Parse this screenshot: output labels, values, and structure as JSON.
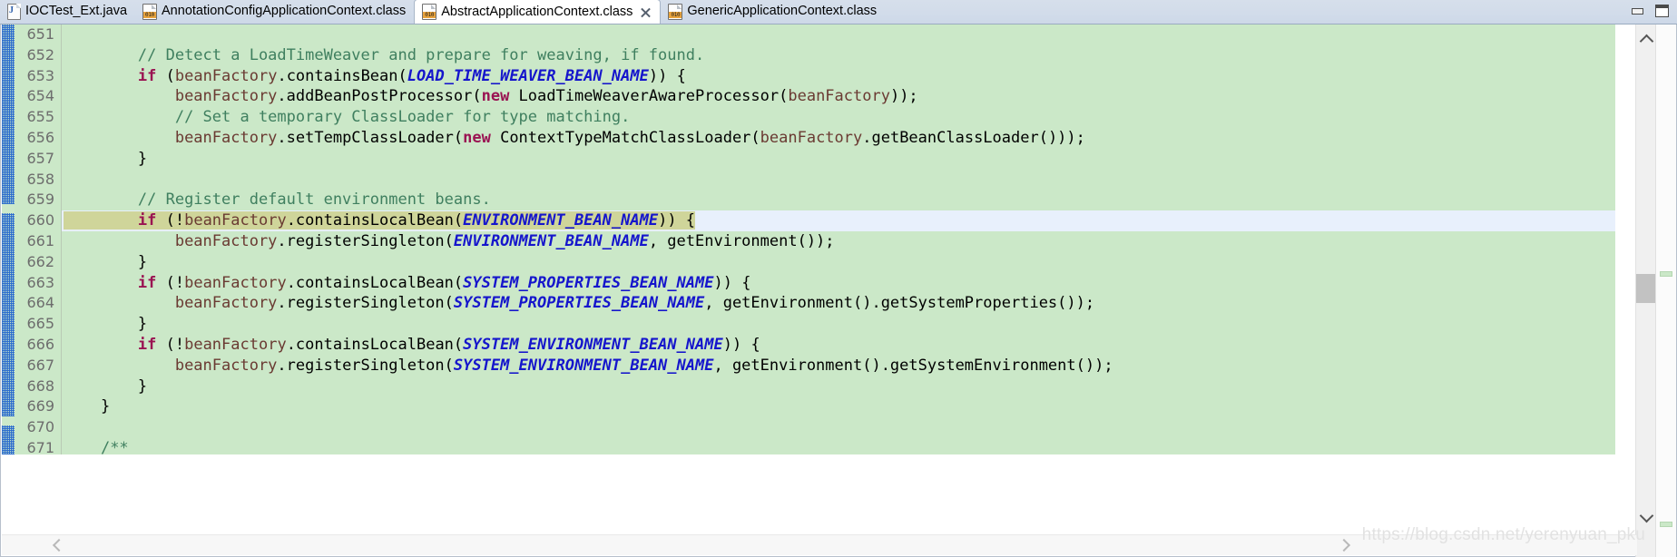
{
  "window": {
    "minimize_label": "Minimize",
    "maximize_label": "Maximize"
  },
  "tabs": [
    {
      "label": "IOCTest_Ext.java",
      "icon": "java-file-icon",
      "active": false,
      "closable": false
    },
    {
      "label": "AnnotationConfigApplicationContext.class",
      "icon": "class-file-icon",
      "active": false,
      "closable": false
    },
    {
      "label": "AbstractApplicationContext.class",
      "icon": "class-file-icon",
      "active": true,
      "closable": true
    },
    {
      "label": "GenericApplicationContext.class",
      "icon": "class-file-icon",
      "active": false,
      "closable": false
    }
  ],
  "editor": {
    "first_line": 651,
    "current_line": 660,
    "fold_line": 671,
    "lines": [
      {
        "n": "651",
        "tokens": []
      },
      {
        "n": "652",
        "tokens": [
          {
            "t": "plain",
            "s": "        "
          },
          {
            "t": "cmt",
            "s": "// Detect a LoadTimeWeaver and prepare for weaving, if found."
          }
        ]
      },
      {
        "n": "653",
        "tokens": [
          {
            "t": "plain",
            "s": "        "
          },
          {
            "t": "kw",
            "s": "if"
          },
          {
            "t": "plain",
            "s": " ("
          },
          {
            "t": "field",
            "s": "beanFactory"
          },
          {
            "t": "plain",
            "s": ".containsBean("
          },
          {
            "t": "const",
            "s": "LOAD_TIME_WEAVER_BEAN_NAME"
          },
          {
            "t": "plain",
            "s": ")) {"
          }
        ]
      },
      {
        "n": "654",
        "tokens": [
          {
            "t": "plain",
            "s": "            "
          },
          {
            "t": "field",
            "s": "beanFactory"
          },
          {
            "t": "plain",
            "s": ".addBeanPostProcessor("
          },
          {
            "t": "kw",
            "s": "new"
          },
          {
            "t": "plain",
            "s": " LoadTimeWeaverAwareProcessor("
          },
          {
            "t": "field",
            "s": "beanFactory"
          },
          {
            "t": "plain",
            "s": "));"
          }
        ]
      },
      {
        "n": "655",
        "tokens": [
          {
            "t": "plain",
            "s": "            "
          },
          {
            "t": "cmt",
            "s": "// Set a temporary ClassLoader for type matching."
          }
        ]
      },
      {
        "n": "656",
        "tokens": [
          {
            "t": "plain",
            "s": "            "
          },
          {
            "t": "field",
            "s": "beanFactory"
          },
          {
            "t": "plain",
            "s": ".setTempClassLoader("
          },
          {
            "t": "kw",
            "s": "new"
          },
          {
            "t": "plain",
            "s": " ContextTypeMatchClassLoader("
          },
          {
            "t": "field",
            "s": "beanFactory"
          },
          {
            "t": "plain",
            "s": ".getBeanClassLoader()));"
          }
        ]
      },
      {
        "n": "657",
        "tokens": [
          {
            "t": "plain",
            "s": "        }"
          }
        ]
      },
      {
        "n": "658",
        "tokens": []
      },
      {
        "n": "659",
        "tokens": [
          {
            "t": "plain",
            "s": "        "
          },
          {
            "t": "cmt",
            "s": "// Register default environment beans."
          }
        ]
      },
      {
        "n": "660",
        "current": true,
        "tokens": [
          {
            "t": "plain",
            "s": "        "
          },
          {
            "t": "kw",
            "s": "if"
          },
          {
            "t": "plain",
            "s": " (!"
          },
          {
            "t": "field",
            "s": "beanFactory"
          },
          {
            "t": "plain",
            "s": ".containsLocalBean("
          },
          {
            "t": "const",
            "s": "ENVIRONMENT_BEAN_NAME"
          },
          {
            "t": "plain",
            "s": ")) {"
          }
        ]
      },
      {
        "n": "661",
        "tokens": [
          {
            "t": "plain",
            "s": "            "
          },
          {
            "t": "field",
            "s": "beanFactory"
          },
          {
            "t": "plain",
            "s": ".registerSingleton("
          },
          {
            "t": "const",
            "s": "ENVIRONMENT_BEAN_NAME"
          },
          {
            "t": "plain",
            "s": ", getEnvironment());"
          }
        ]
      },
      {
        "n": "662",
        "tokens": [
          {
            "t": "plain",
            "s": "        }"
          }
        ]
      },
      {
        "n": "663",
        "tokens": [
          {
            "t": "plain",
            "s": "        "
          },
          {
            "t": "kw",
            "s": "if"
          },
          {
            "t": "plain",
            "s": " (!"
          },
          {
            "t": "field",
            "s": "beanFactory"
          },
          {
            "t": "plain",
            "s": ".containsLocalBean("
          },
          {
            "t": "const",
            "s": "SYSTEM_PROPERTIES_BEAN_NAME"
          },
          {
            "t": "plain",
            "s": ")) {"
          }
        ]
      },
      {
        "n": "664",
        "tokens": [
          {
            "t": "plain",
            "s": "            "
          },
          {
            "t": "field",
            "s": "beanFactory"
          },
          {
            "t": "plain",
            "s": ".registerSingleton("
          },
          {
            "t": "const",
            "s": "SYSTEM_PROPERTIES_BEAN_NAME"
          },
          {
            "t": "plain",
            "s": ", getEnvironment().getSystemProperties());"
          }
        ]
      },
      {
        "n": "665",
        "tokens": [
          {
            "t": "plain",
            "s": "        }"
          }
        ]
      },
      {
        "n": "666",
        "tokens": [
          {
            "t": "plain",
            "s": "        "
          },
          {
            "t": "kw",
            "s": "if"
          },
          {
            "t": "plain",
            "s": " (!"
          },
          {
            "t": "field",
            "s": "beanFactory"
          },
          {
            "t": "plain",
            "s": ".containsLocalBean("
          },
          {
            "t": "const",
            "s": "SYSTEM_ENVIRONMENT_BEAN_NAME"
          },
          {
            "t": "plain",
            "s": ")) {"
          }
        ]
      },
      {
        "n": "667",
        "tokens": [
          {
            "t": "plain",
            "s": "            "
          },
          {
            "t": "field",
            "s": "beanFactory"
          },
          {
            "t": "plain",
            "s": ".registerSingleton("
          },
          {
            "t": "const",
            "s": "SYSTEM_ENVIRONMENT_BEAN_NAME"
          },
          {
            "t": "plain",
            "s": ", getEnvironment().getSystemEnvironment());"
          }
        ]
      },
      {
        "n": "668",
        "tokens": [
          {
            "t": "plain",
            "s": "        }"
          }
        ]
      },
      {
        "n": "669",
        "tokens": [
          {
            "t": "plain",
            "s": "    }"
          }
        ]
      },
      {
        "n": "670",
        "tokens": []
      },
      {
        "n": "671",
        "fold": true,
        "tokens": [
          {
            "t": "plain",
            "s": "    "
          },
          {
            "t": "cmt",
            "s": "/**"
          }
        ]
      }
    ]
  },
  "scrollbars": {
    "vertical_up_label": "Scroll up",
    "vertical_down_label": "Scroll down",
    "horizontal_left_label": "Scroll left",
    "horizontal_right_label": "Scroll right"
  },
  "watermark": "https://blog.csdn.net/yerenyuan_pku",
  "colors": {
    "code_background": "#cbe8c8",
    "current_line": "#e8f0fc",
    "selection": "#cfd59a",
    "comment": "#3f7f5f",
    "keyword": "#9a1352",
    "constant": "#1515cc",
    "field": "#6a3a32",
    "tabbar": "#d2dcea"
  }
}
